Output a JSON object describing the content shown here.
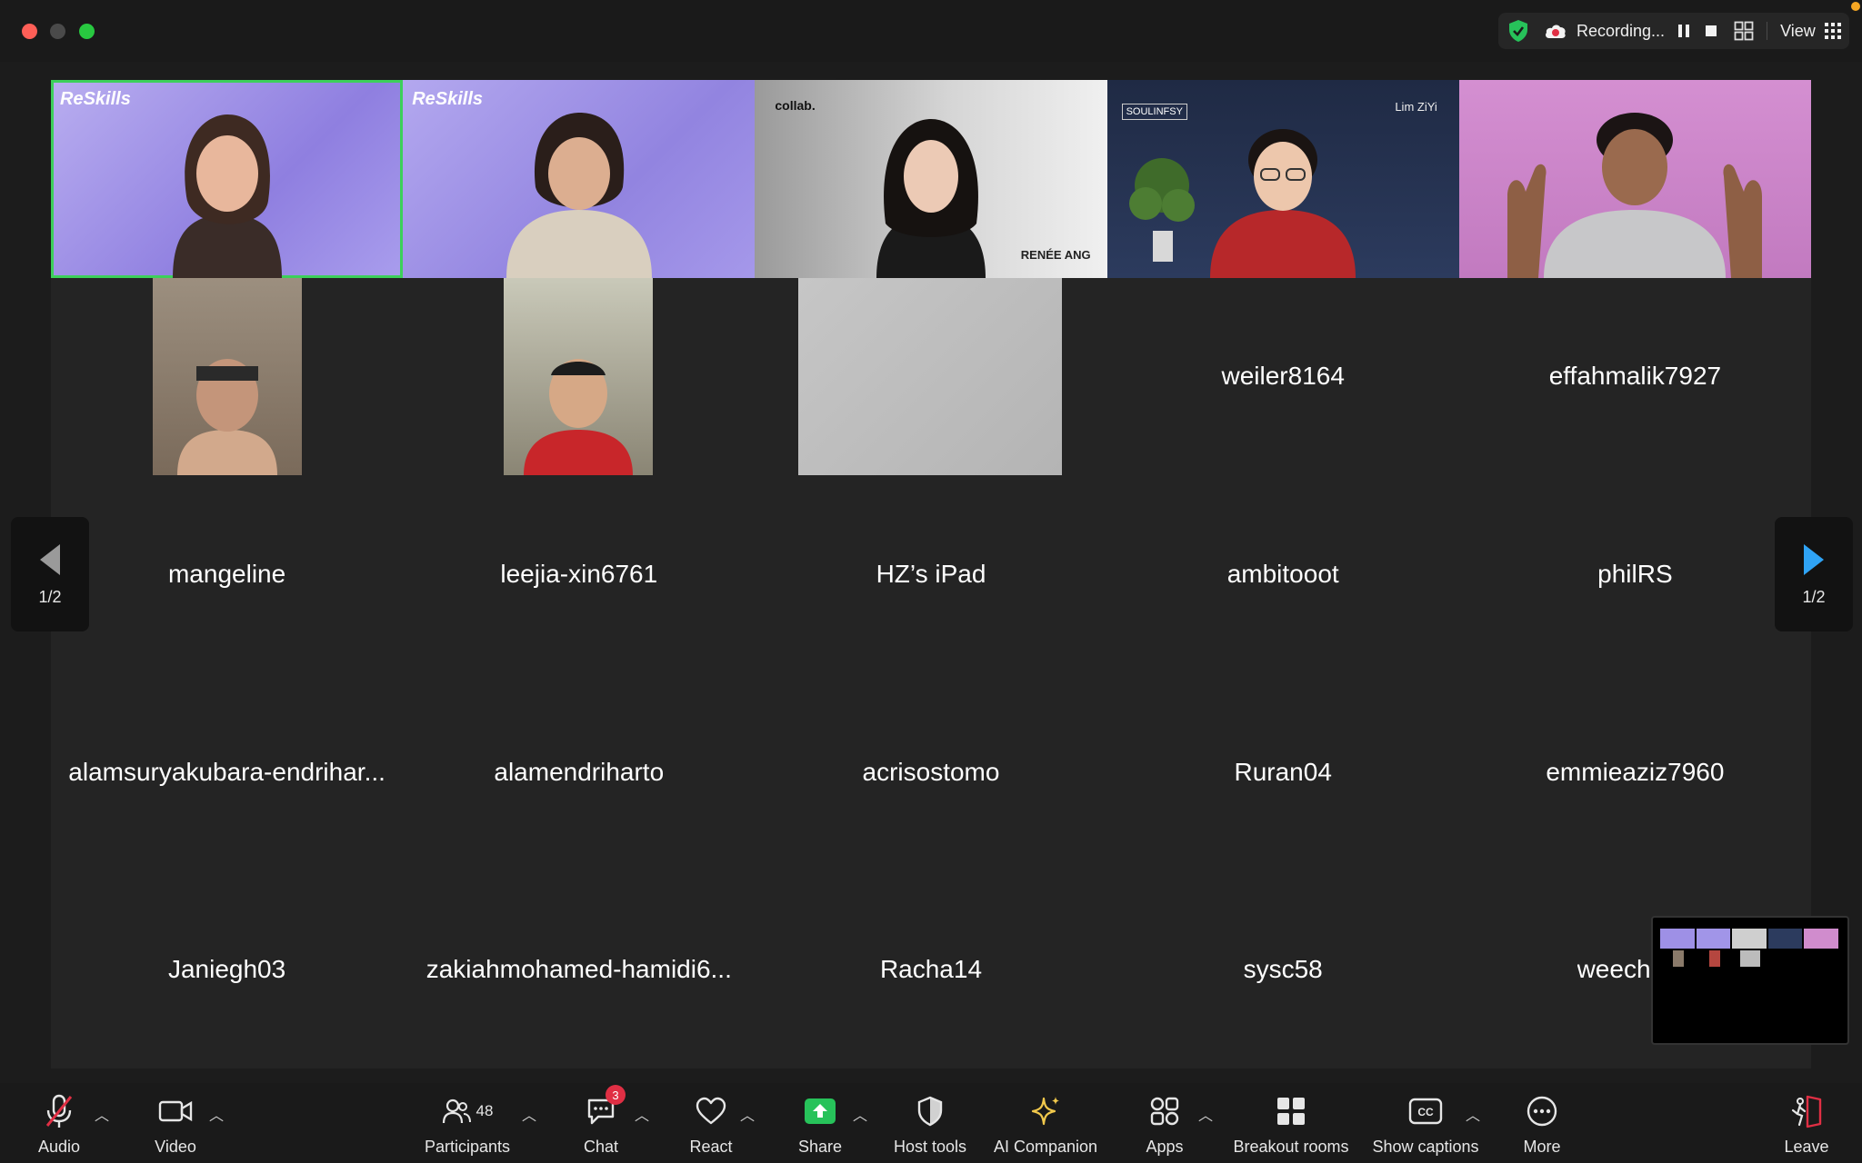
{
  "topbar": {
    "recording_label": "Recording...",
    "view_label": "View"
  },
  "gallery": {
    "video_tiles": [
      {
        "cam_label": "ReSkills",
        "caption": ""
      },
      {
        "cam_label": "ReSkills",
        "caption": ""
      },
      {
        "cam_label": "collab.",
        "caption": "RENÉE ANG"
      },
      {
        "cam_label": "SOULINFSY",
        "caption": "Lim ZiYi"
      },
      {
        "cam_label": "",
        "caption": ""
      }
    ],
    "row2_names": [
      "weiler8164",
      "effahmalik7927"
    ],
    "row3_names": [
      "mangeline",
      "leejia-xin6761",
      "HZ’s iPad",
      "ambitooot",
      "philRS"
    ],
    "row4_names": [
      "alamsuryakubara-endrihar...",
      "alamendriharto",
      "acrisostomo",
      "Ruran04",
      "emmieaziz7960"
    ],
    "row5_names": [
      "Janiegh03",
      "zakiahmohamed-hamidi6...",
      "Racha14",
      "sysc58",
      "weechin-e"
    ]
  },
  "pager": {
    "left_page": "1/2",
    "right_page": "1/2"
  },
  "toolbar": {
    "audio": "Audio",
    "video": "Video",
    "participants": "Participants",
    "participants_count": "48",
    "chat": "Chat",
    "chat_badge": "3",
    "react": "React",
    "share": "Share",
    "host_tools": "Host tools",
    "ai_companion": "AI Companion",
    "apps": "Apps",
    "breakout_rooms": "Breakout rooms",
    "show_captions": "Show captions",
    "more": "More",
    "leave": "Leave"
  },
  "colors": {
    "active_speaker": "#3cd05a",
    "share_green": "#27c25a",
    "chat_badge": "#e02f44",
    "pager_arrow": "#2fa3f5",
    "ai_star": "#f2c94c"
  }
}
